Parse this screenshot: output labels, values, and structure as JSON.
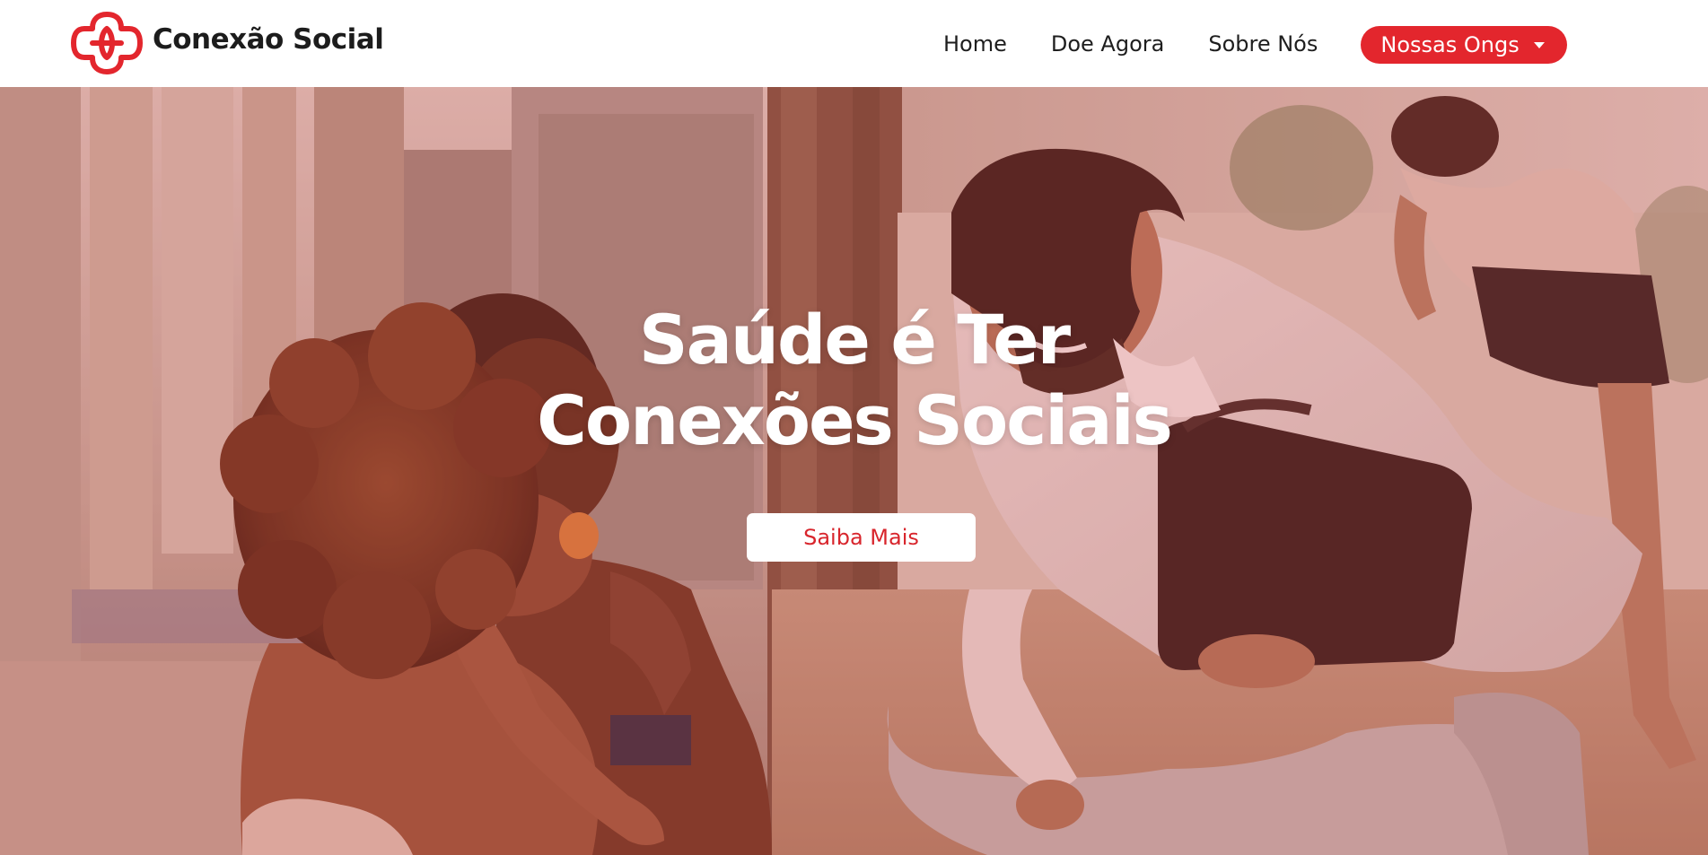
{
  "brand": {
    "name": "Conexão Social",
    "logo_icon": "interlocking-cross-logo",
    "logo_color": "#e3262d"
  },
  "nav": {
    "links": [
      {
        "label": "Home"
      },
      {
        "label": "Doe Agora"
      },
      {
        "label": "Sobre Nós"
      }
    ],
    "dropdown": {
      "label": "Nossas Ongs",
      "icon": "caret-down-icon",
      "bg_color": "#e3262d"
    }
  },
  "hero": {
    "title_line1": "Saúde é Ter",
    "title_line2": "Conexões Sociais",
    "cta_label": "Saiba Mais",
    "overlay_color": "#c43a3c",
    "background_icon": "hero-photo-doctor-with-children"
  }
}
